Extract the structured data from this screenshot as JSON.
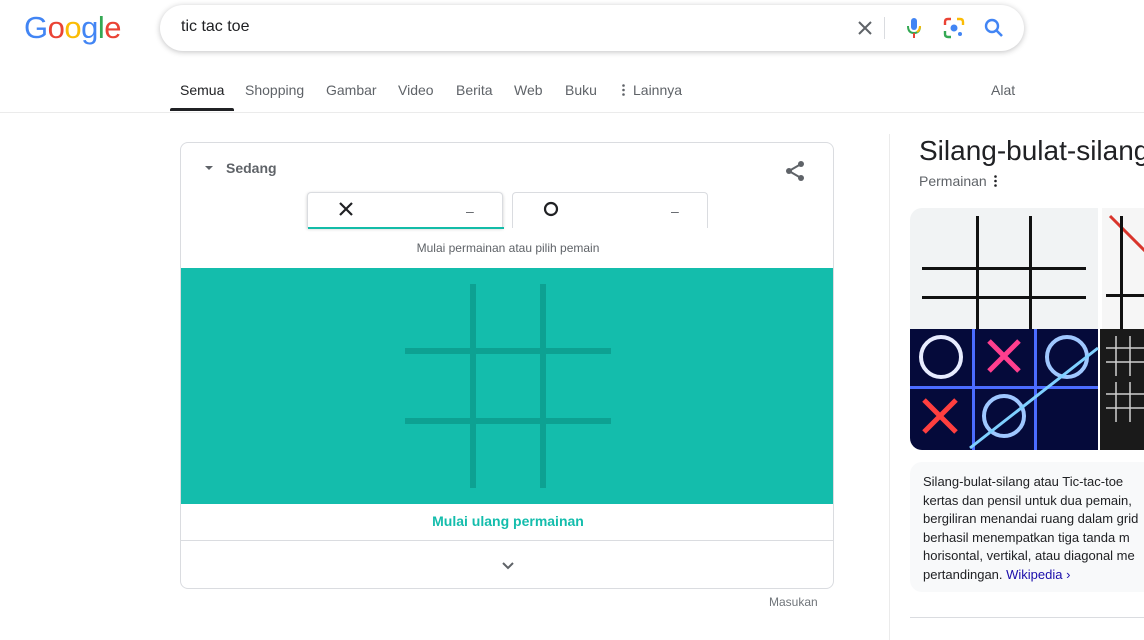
{
  "logo": {
    "letters": [
      {
        "ch": "G",
        "color": "#4285F4"
      },
      {
        "ch": "o",
        "color": "#EA4335"
      },
      {
        "ch": "o",
        "color": "#FBBC05"
      },
      {
        "ch": "g",
        "color": "#4285F4"
      },
      {
        "ch": "l",
        "color": "#34A853"
      },
      {
        "ch": "e",
        "color": "#EA4335"
      }
    ]
  },
  "search": {
    "query": "tic tac toe",
    "icons": [
      "close-icon",
      "microphone-icon",
      "lens-icon",
      "search-icon"
    ]
  },
  "tabs": {
    "items": [
      "Semua",
      "Shopping",
      "Gambar",
      "Video",
      "Berita",
      "Web",
      "Buku",
      "Lainnya"
    ],
    "active": "Semua",
    "tools": "Alat"
  },
  "game": {
    "difficulty": "Sedang",
    "players": [
      {
        "mark": "X",
        "score": "–"
      },
      {
        "mark": "O",
        "score": "–"
      }
    ],
    "hint": "Mulai permainan atau pilih pemain",
    "restart": "Mulai ulang permainan",
    "feedback": "Masukan",
    "colors": {
      "board": "#14bdac",
      "grid": "#0da192"
    }
  },
  "knowledge_panel": {
    "title": "Silang-bulat-silang",
    "subtitle": "Permainan",
    "description_lines": [
      "Silang-bulat-silang atau Tic-tac-toe",
      "kertas dan pensil untuk dua pemain,",
      "bergiliran menandai ruang dalam grid",
      "berhasil menempatkan tiga tanda m",
      "horisontal, vertikal, atau diagonal me",
      "pertandingan."
    ],
    "source_link": "Wikipedia ›"
  }
}
